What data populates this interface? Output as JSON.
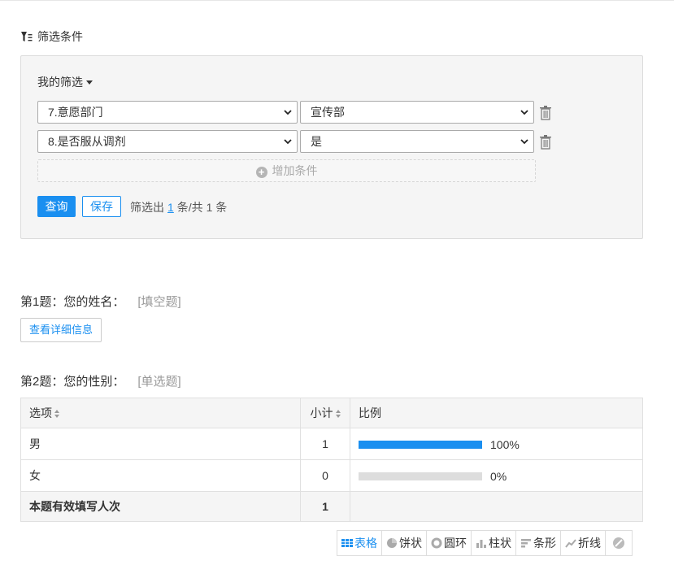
{
  "filter_section": {
    "title": "筛选条件",
    "my_filter_label": "我的筛选",
    "conditions": [
      {
        "field": "7.意愿部门",
        "value": "宣传部"
      },
      {
        "field": "8.是否服从调剂",
        "value": "是"
      }
    ],
    "add_condition_label": "增加条件",
    "query_button": "查询",
    "save_button": "保存",
    "result_prefix": "筛选出",
    "result_count": "1",
    "result_suffix": "条/共 1 条"
  },
  "questions": [
    {
      "title": "第1题：您的姓名：",
      "type": "[填空题]",
      "detail_button": "查看详细信息"
    },
    {
      "title": "第2题：您的性别：",
      "type": "[单选题]"
    }
  ],
  "stats_table": {
    "headers": {
      "option": "选项",
      "count": "小计",
      "ratio": "比例"
    },
    "rows": [
      {
        "option": "男",
        "count": "1",
        "percent": "100%",
        "fraction": 1.0
      },
      {
        "option": "女",
        "count": "0",
        "percent": "0%",
        "fraction": 0.0
      }
    ],
    "total": {
      "label": "本题有效填写人次",
      "count": "1"
    }
  },
  "chart_tabs": [
    {
      "label": "表格",
      "icon": "table-icon",
      "active": true
    },
    {
      "label": "饼状",
      "icon": "pie-icon"
    },
    {
      "label": "圆环",
      "icon": "donut-icon"
    },
    {
      "label": "柱状",
      "icon": "column-icon"
    },
    {
      "label": "条形",
      "icon": "bar-icon"
    },
    {
      "label": "折线",
      "icon": "line-icon"
    },
    {
      "label": "",
      "icon": "hide-icon"
    }
  ],
  "colors": {
    "accent": "#1a8ff0",
    "bar_bg": "#dddddd",
    "panel_bg": "#f5f5f5"
  }
}
